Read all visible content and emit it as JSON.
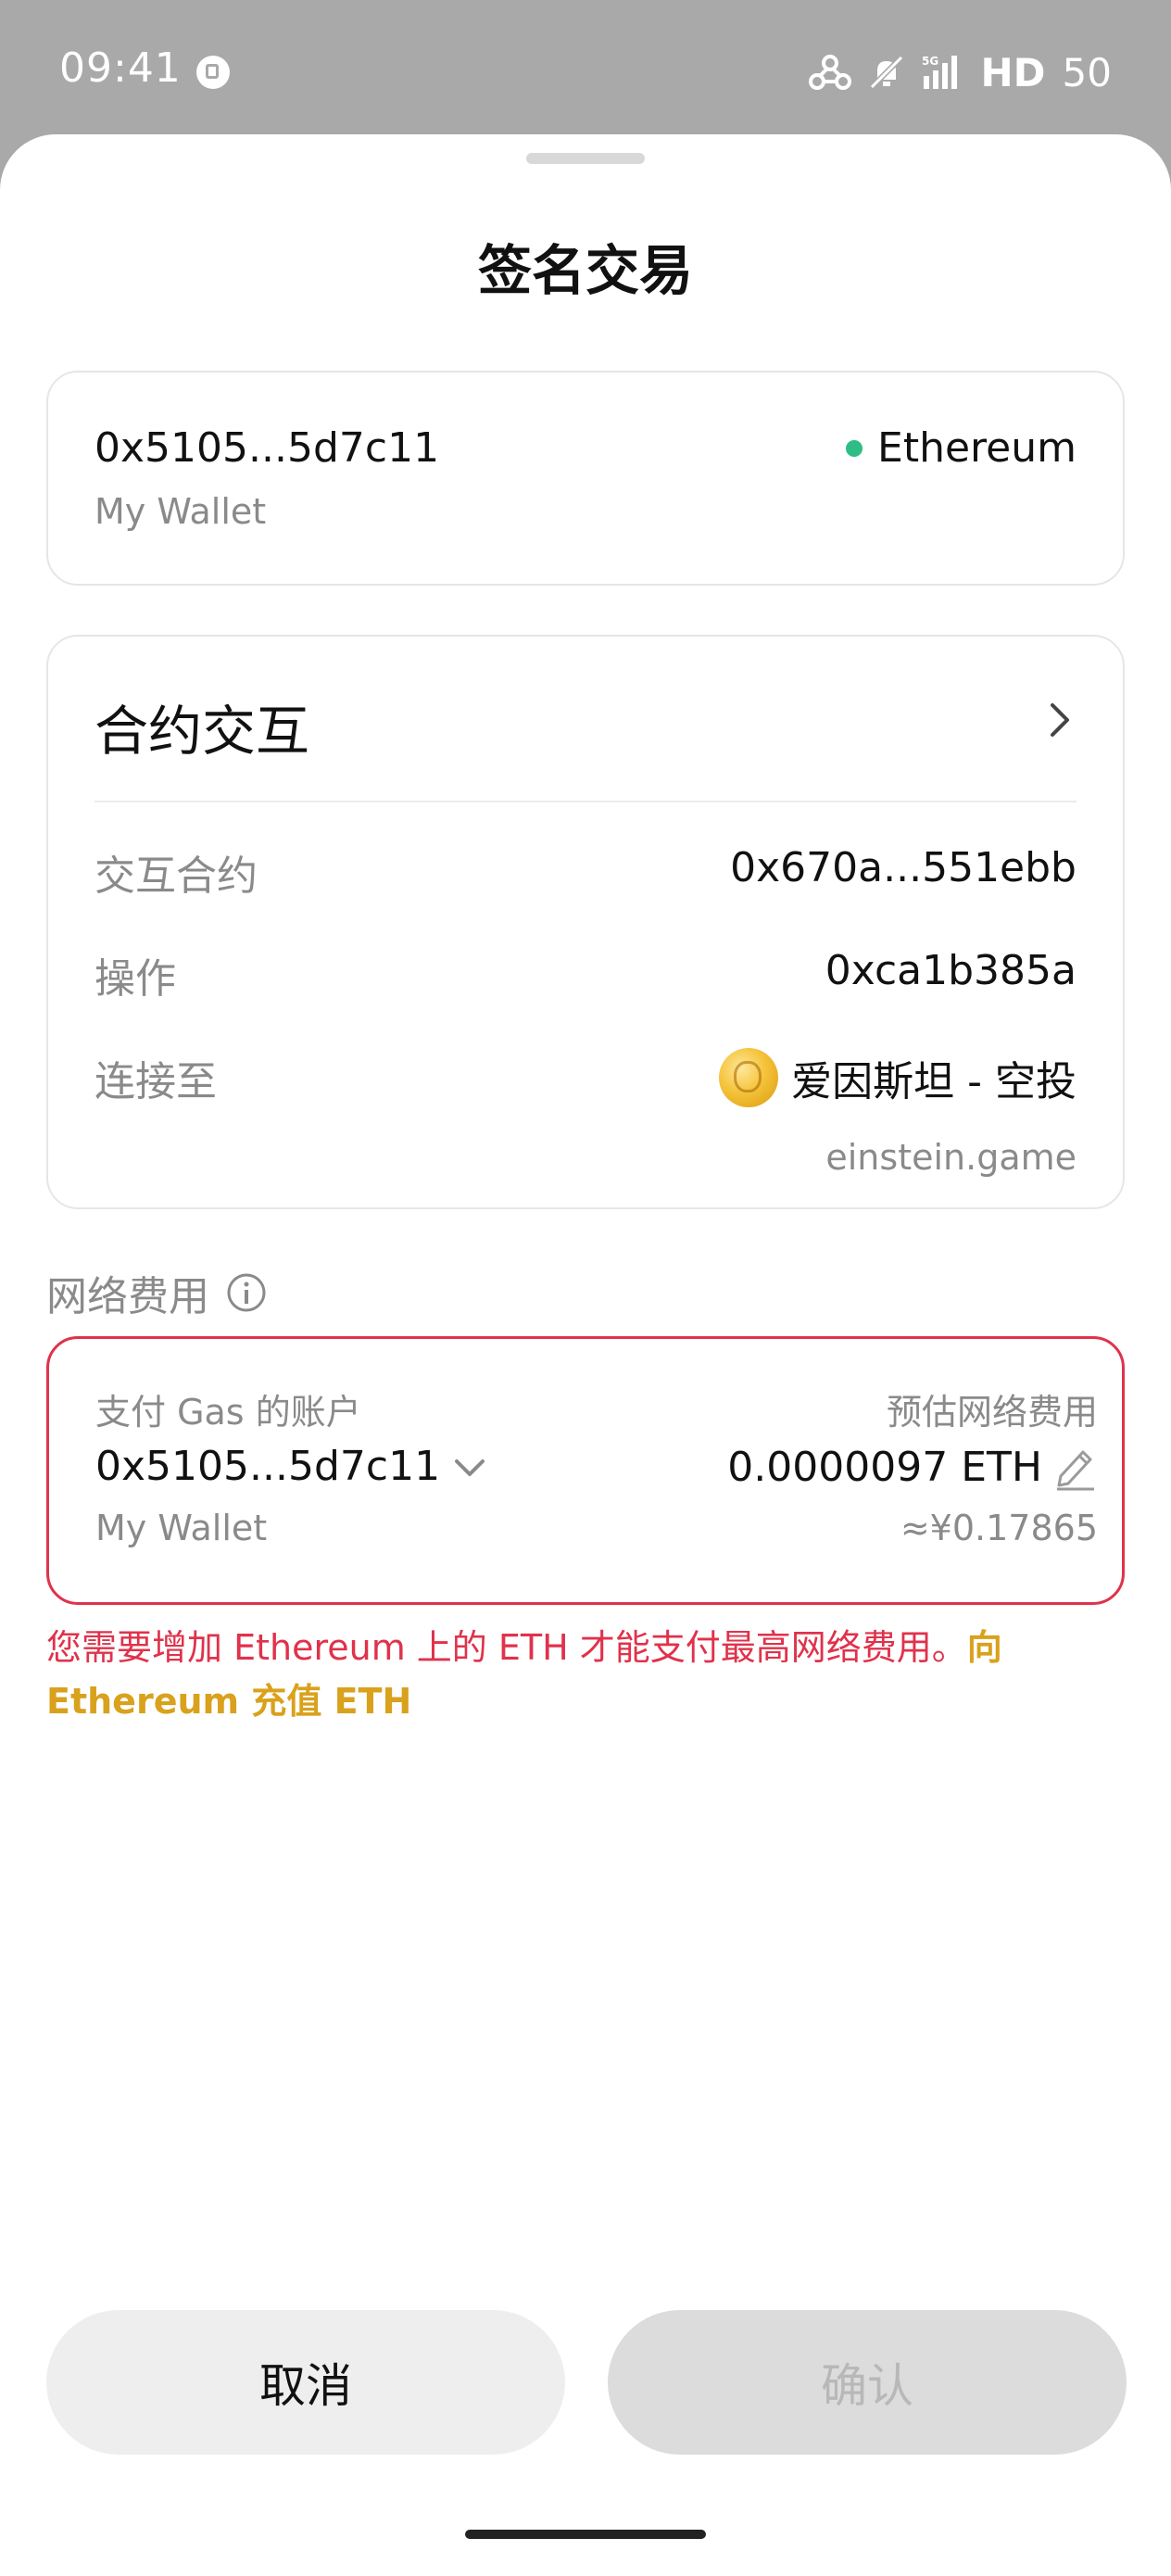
{
  "status_bar": {
    "time": "09:41",
    "network_type": "HD",
    "battery": "50",
    "icons": [
      "app-notification-icon",
      "hotspot-icon",
      "mute-icon",
      "signal-5g-icon"
    ]
  },
  "sheet": {
    "title": "签名交易"
  },
  "account": {
    "address": "0x5105...5d7c11",
    "wallet_name": "My Wallet",
    "network": "Ethereum",
    "network_dot_color": "#2ebd85"
  },
  "contract": {
    "header": "合约交互",
    "rows": [
      {
        "label": "交互合约",
        "value": "0x670a...551ebb"
      },
      {
        "label": "操作",
        "value": "0xca1b385a"
      },
      {
        "label": "连接至",
        "value": "爱因斯坦 - 空投"
      }
    ],
    "dapp_domain": "einstein.game"
  },
  "fee": {
    "section_label": "网络费用",
    "payer_label": "支付 Gas 的账户",
    "payer_address": "0x5105...5d7c11",
    "payer_wallet": "My Wallet",
    "estimate_label": "预估网络费用",
    "estimate_value": "0.0000097 ETH",
    "estimate_fiat": "≈¥0.17865",
    "error_border_color": "#e0324b"
  },
  "warning": {
    "text": "您需要增加 Ethereum 上的 ETH 才能支付最高网络费用。",
    "link": "向 Ethereum 充值 ETH"
  },
  "buttons": {
    "cancel": "取消",
    "confirm": "确认"
  }
}
